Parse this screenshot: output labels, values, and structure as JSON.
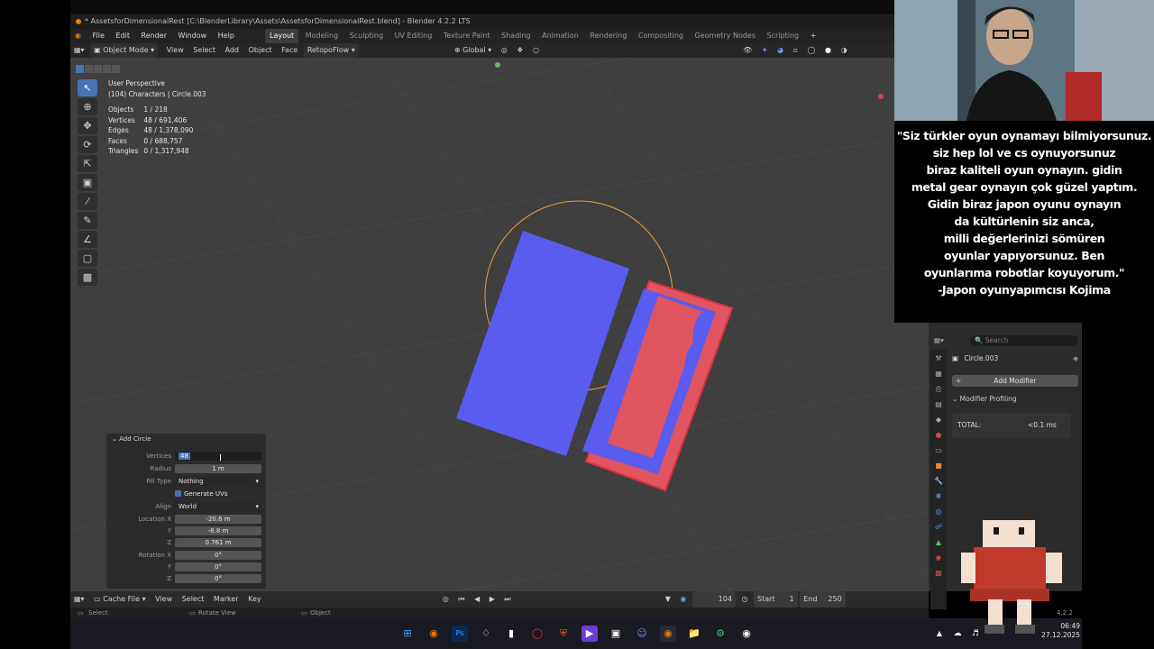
{
  "window": {
    "title": "* AssetsforDimensionalRest [C:\\BlenderLibrary\\Assets\\AssetsforDimensionalRest.blend] - Blender 4.2.2 LTS"
  },
  "menu": {
    "items": [
      "File",
      "Edit",
      "Render",
      "Window",
      "Help"
    ],
    "workspaces": [
      "Layout",
      "Modeling",
      "Sculpting",
      "UV Editing",
      "Texture Paint",
      "Shading",
      "Animation",
      "Rendering",
      "Compositing",
      "Geometry Nodes",
      "Scripting"
    ],
    "active_workspace": "Layout",
    "add_tab": "+"
  },
  "header": {
    "mode": "Object Mode",
    "items": [
      "View",
      "Select",
      "Add",
      "Object",
      "Face"
    ],
    "addon": "RetopoFlow",
    "transform_orientation": "Global"
  },
  "viewport_overlay": {
    "perspective": "User Perspective",
    "collection": "(104) Characters | Circle.003",
    "stats": [
      {
        "label": "Objects",
        "value": "1 / 218"
      },
      {
        "label": "Vertices",
        "value": "48 / 691,406"
      },
      {
        "label": "Edges",
        "value": "48 / 1,378,090"
      },
      {
        "label": "Faces",
        "value": "0 / 688,757"
      },
      {
        "label": "Triangles",
        "value": "0 / 1,317,948"
      }
    ]
  },
  "toolbar": {
    "tools": [
      "select-box-icon",
      "cursor-icon",
      "move-icon",
      "rotate-icon",
      "scale-icon",
      "transform-icon",
      "annotate-icon",
      "annotate-line-icon",
      "measure-icon",
      "add-cube-icon",
      "extrude-icon"
    ]
  },
  "operator_panel": {
    "title": "Add Circle",
    "vertices_label": "Vertices",
    "vertices_value": "48",
    "radius_label": "Radius",
    "radius_value": "1 m",
    "fill_type_label": "Fill Type",
    "fill_type_value": "Nothing",
    "generate_uvs_label": "Generate UVs",
    "align_label": "Align",
    "align_value": "World",
    "location_label": "Location X",
    "location_x": "-20.6 m",
    "location_y_label": "Y",
    "location_y": "-8.8 m",
    "location_z_label": "Z",
    "location_z": "0.761 m",
    "rotation_label": "Rotation X",
    "rotation_x": "0°",
    "rotation_y_label": "Y",
    "rotation_y": "0°",
    "rotation_z_label": "Z",
    "rotation_z": "0°"
  },
  "properties": {
    "search_placeholder": "Search",
    "object_name": "Circle.003",
    "add_modifier": "Add Modifier",
    "section": "Modifier Profiling",
    "total_label": "TOTAL:",
    "total_value": "<0.1 ms"
  },
  "timeline": {
    "editor": "Cache File",
    "items": [
      "View",
      "Select",
      "Marker",
      "Key"
    ],
    "current_frame": "104",
    "start_label": "Start",
    "start_value": "1",
    "end_label": "End",
    "end_value": "250"
  },
  "statusbar": {
    "left": "Select",
    "middle": "Rotate View",
    "right": "Object",
    "version": "4.2.2"
  },
  "quote": {
    "lines": [
      "\"Siz türkler oyun oynamayı bilmiyorsunuz.",
      "siz hep lol ve cs oynuyorsunuz",
      "biraz kaliteli oyun oynayın. gidin",
      "metal gear oynayın çok güzel yaptım.",
      "Gidin biraz japon oyunu oynayın",
      "da kültürlenin siz anca,",
      "milli değerlerinizi sömüren",
      "oyunlar yapıyorsunuz. Ben",
      "oyunlarıma robotlar koyuyorum.\"",
      "-Japon oyunyapımcısı Kojima"
    ]
  },
  "clock": {
    "time": "06:49",
    "date": "27.12.2025"
  },
  "colors": {
    "accent": "#4772b3",
    "object_blue": "#5a5cf0",
    "object_red": "#e05560",
    "selection_orange": "#e8a040",
    "viewport_bg": "#3f3f3f"
  }
}
